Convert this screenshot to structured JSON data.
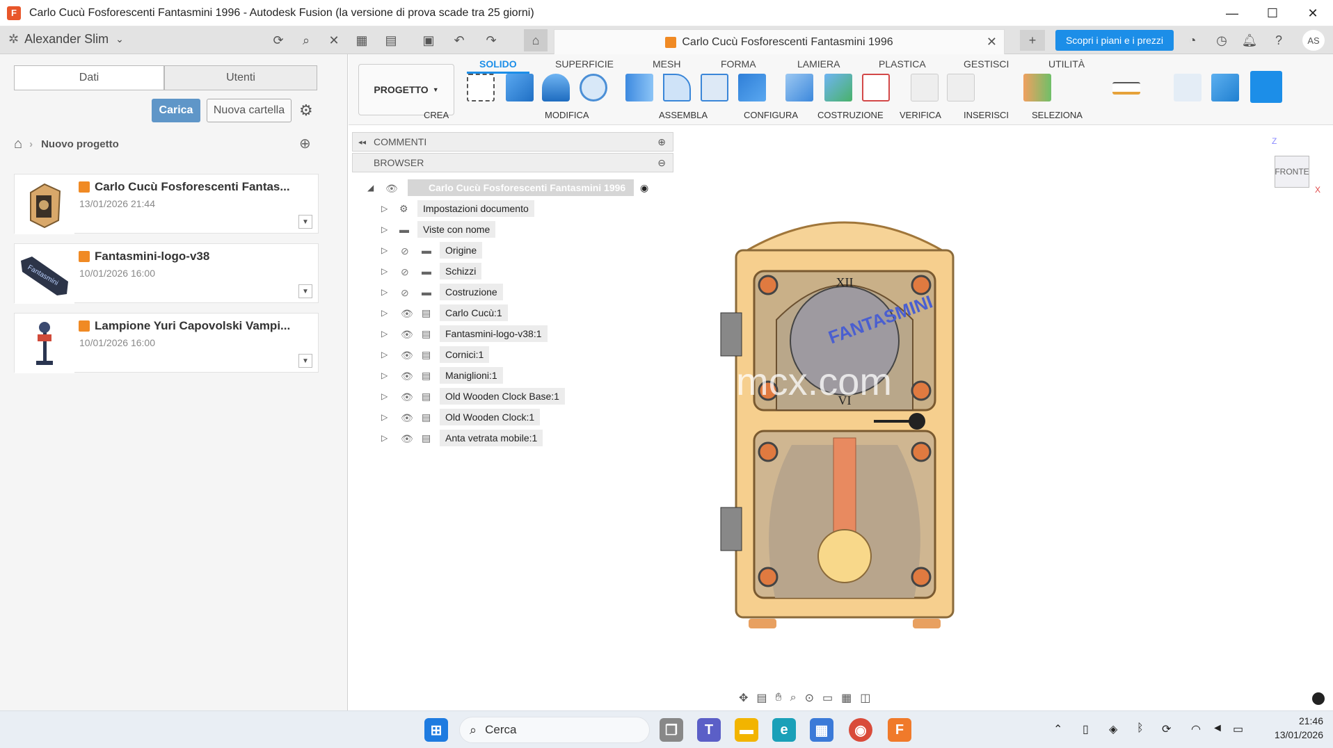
{
  "window": {
    "title": "Carlo Cucù Fosforescenti Fantasmini 1996 - Autodesk Fusion (la versione di prova scade tra 25 giorni)",
    "controls": [
      "—",
      "☐",
      "✕"
    ]
  },
  "topbar": {
    "user_name": "Alexander Slim",
    "doc_tab_title": "Carlo Cucù Fosforescenti Fantasmini 1996",
    "promo_button": "Scopri i piani e i prezzi",
    "avatar_initials": "AS"
  },
  "leftpanel": {
    "tabs": [
      "Dati",
      "Utenti"
    ],
    "upload_button": "Carica",
    "new_folder_button": "Nuova cartella",
    "breadcrumb": "Nuovo progetto",
    "items": [
      {
        "name": "Carlo Cucù Fosforescenti Fantas...",
        "date": "13/01/2026 21:44"
      },
      {
        "name": "Fantasmini-logo-v38",
        "date": "10/01/2026 16:00"
      },
      {
        "name": "Lampione Yuri Capovolski Vampi...",
        "date": "10/01/2026 16:00"
      }
    ]
  },
  "toolbar": {
    "workspace": "PROGETTO",
    "tabs": [
      "SOLIDO",
      "SUPERFICIE",
      "MESH",
      "FORMA",
      "LAMIERA",
      "PLASTICA",
      "GESTISCI",
      "UTILITÀ"
    ],
    "active_tab": "SOLIDO",
    "groups": [
      "CREA",
      "MODIFICA",
      "ASSEMBLA",
      "CONFIGURA",
      "COSTRUZIONE",
      "VERIFICA",
      "INSERISCI",
      "SELEZIONA"
    ]
  },
  "browser": {
    "comments_label": "COMMENTI",
    "browser_label": "BROWSER",
    "root": "Carlo Cucù Fosforescenti Fantasmini 1996",
    "items": [
      "Impostazioni documento",
      "Viste con nome",
      "Origine",
      "Schizzi",
      "Costruzione",
      "Carlo Cucù:1",
      "Fantasmini-logo-v38:1",
      "Cornici:1",
      "Maniglioni:1",
      "Old Wooden Clock Base:1",
      "Old Wooden Clock:1",
      "Anta vetrata mobile:1"
    ]
  },
  "viewcube": {
    "face": "FRONTE",
    "axis_z": "Z",
    "axis_x": "X"
  },
  "watermark": "mcx.com",
  "taskbar": {
    "search_placeholder": "Cerca",
    "time": "21:46",
    "date": "13/01/2026"
  },
  "colors": {
    "accent": "#1c8ee8",
    "fusion_orange": "#f08a24",
    "wood": "#f6cf8e"
  }
}
